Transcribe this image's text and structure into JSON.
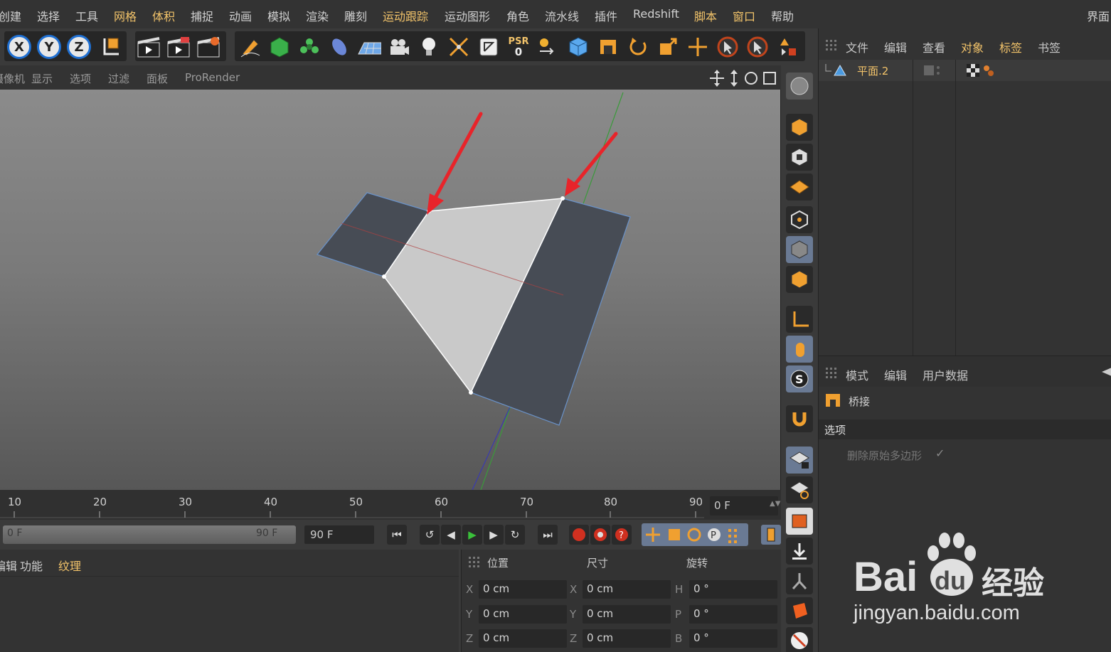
{
  "menubar": {
    "items": [
      "创建",
      "选择",
      "工具",
      "网格",
      "体积",
      "捕捉",
      "动画",
      "模拟",
      "渲染",
      "雕刻",
      "运动跟踪",
      "运动图形",
      "角色",
      "流水线",
      "插件",
      "Redshift",
      "脚本",
      "窗口",
      "帮助"
    ],
    "right_label": "界面"
  },
  "toolbar": {
    "axis_x": "X",
    "axis_y": "Y",
    "axis_z": "Z",
    "psr_label": "PSR",
    "psr_value": "0"
  },
  "viewport_menu": {
    "items": [
      "摄像机",
      "显示",
      "选项",
      "过滤",
      "面板",
      "ProRender"
    ]
  },
  "object_manager": {
    "tabs": [
      "文件",
      "编辑",
      "查看",
      "对象",
      "标签",
      "书签"
    ],
    "active_tab": "对象",
    "objects": [
      {
        "name": "平面.2"
      }
    ]
  },
  "attributes": {
    "tabs": [
      "模式",
      "编辑",
      "用户数据"
    ],
    "tool_name": "桥接",
    "section": "选项",
    "option_label": "删除原始多边形",
    "option_checked": "✓"
  },
  "timeline": {
    "ticks": [
      "10",
      "20",
      "30",
      "40",
      "50",
      "60",
      "70",
      "80",
      "90"
    ],
    "current_frame": "0 F"
  },
  "playback": {
    "range_start": "0 F",
    "range_end": "90 F",
    "end_frame": "90 F"
  },
  "material_panel": {
    "tabs": [
      "编辑",
      "功能",
      "纹理"
    ]
  },
  "coordinates": {
    "headers": [
      "位置",
      "尺寸",
      "旋转"
    ],
    "rows": [
      {
        "pos_axis": "X",
        "pos": "0 cm",
        "size_axis": "X",
        "size": "0 cm",
        "rot_axis": "H",
        "rot": "0 °"
      },
      {
        "pos_axis": "Y",
        "pos": "0 cm",
        "size_axis": "Y",
        "size": "0 cm",
        "rot_axis": "P",
        "rot": "0 °"
      },
      {
        "pos_axis": "Z",
        "pos": "0 cm",
        "size_axis": "Z",
        "size": "0 cm",
        "rot_axis": "B",
        "rot": "0 °"
      }
    ]
  },
  "watermark": {
    "brand": "Bai",
    "du": "du",
    "cn": "经验",
    "url": "jingyan.baidu.com"
  },
  "colors": {
    "accent": "#f2c36a",
    "axis_blue": "#1f6fd1",
    "arrow_red": "#e8242a",
    "selected_poly": "#c9c9c9",
    "poly_dark": "#474c55"
  }
}
